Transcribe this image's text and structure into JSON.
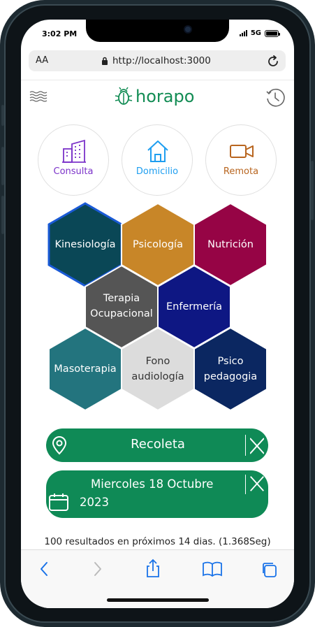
{
  "status": {
    "time": "3:02 PM",
    "network": "5G"
  },
  "browser": {
    "aa": "AA",
    "url": "http://localhost:3000"
  },
  "brand": {
    "name": "horapo",
    "color": "#128c54"
  },
  "modes": [
    {
      "label": "Consulta",
      "icon": "building-icon",
      "color": "#7b32c9"
    },
    {
      "label": "Domicilio",
      "icon": "home-icon",
      "color": "#1e9ef0"
    },
    {
      "label": "Remota",
      "icon": "video-camera-icon",
      "color": "#b8651f"
    }
  ],
  "specialties": [
    {
      "label": "Kinesiología",
      "color": "#0a4756",
      "selected": true
    },
    {
      "label": "Psicología",
      "color": "#c88628"
    },
    {
      "label": "Nutrición",
      "color": "#960445"
    },
    {
      "label_line1": "Terapia",
      "label_line2": "Ocupacional",
      "color": "#555555"
    },
    {
      "label": "Enfermería",
      "color": "#0e1783"
    },
    {
      "label": "Masoterapia",
      "color": "#23747e"
    },
    {
      "label_line1": "Fono",
      "label_line2": "audiología",
      "color": "#dcdcdc",
      "text_color": "#333333"
    },
    {
      "label_line1": "Psico",
      "label_line2": "pedagogia",
      "color": "#0b2761"
    }
  ],
  "location_filter": {
    "label": "Recoleta",
    "icon": "map-pin-icon"
  },
  "date_filter": {
    "line1": "Miercoles 18 Octubre",
    "line2": "2023",
    "icon": "calendar-icon"
  },
  "results_text": "100 resultados en próximos 14 dias. (1.368Seg)",
  "accent_green": "#0f8a56"
}
